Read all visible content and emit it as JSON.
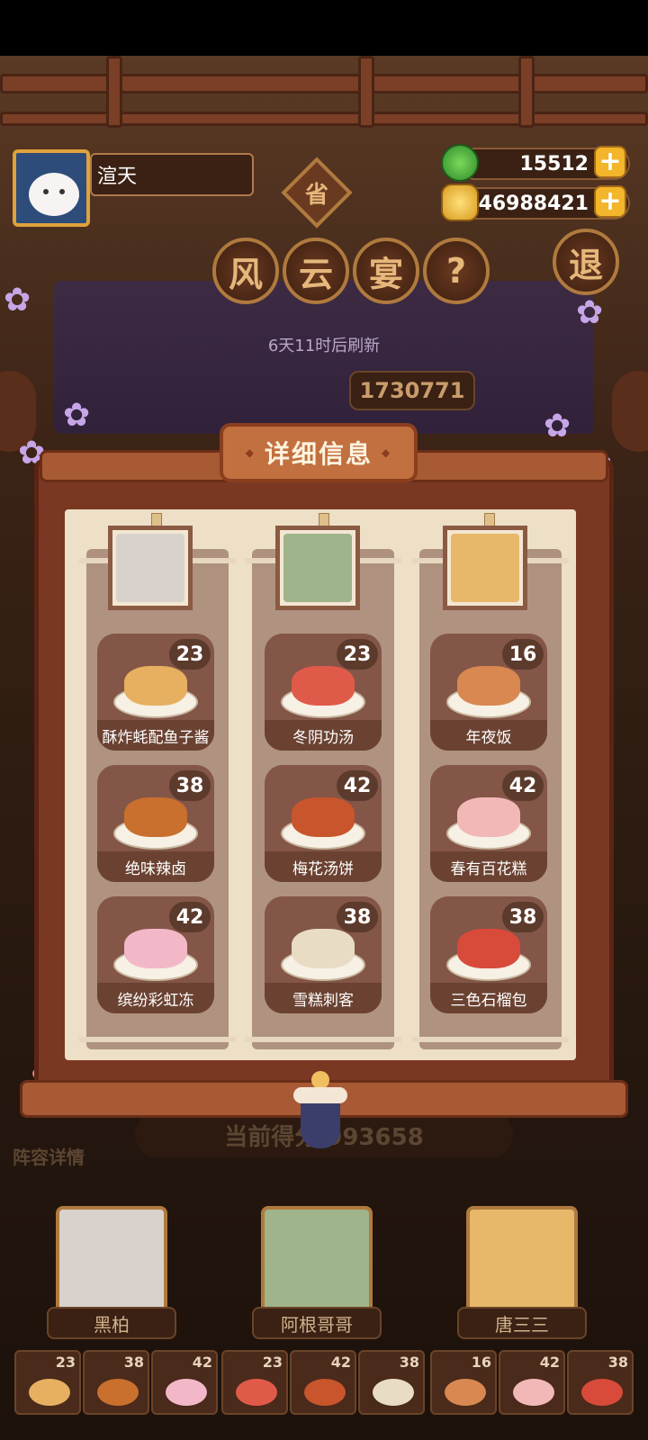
{
  "player": {
    "name": "渲天",
    "avatar_icon": "cat-avatar-icon"
  },
  "currency": {
    "jade": {
      "value": "15512",
      "icon": "jade-coin-icon",
      "color": "#3fae3a"
    },
    "gold": {
      "value": "46988421",
      "icon": "gold-coin-icon",
      "color": "#e7b23a"
    }
  },
  "event": {
    "province_label": "省",
    "title_chars": [
      "风",
      "云",
      "宴"
    ],
    "help_label": "?",
    "exit_label": "退",
    "refresh_text": "6天11时后刷新",
    "score_tag": "1730771"
  },
  "modal": {
    "title": "详细信息",
    "columns": [
      {
        "character": "黑柏",
        "portrait_color": "#d9d2cc",
        "dishes": [
          {
            "name": "酥炸蚝配鱼子酱",
            "count": "23",
            "color": "#e6b060"
          },
          {
            "name": "绝味辣卤",
            "count": "38",
            "color": "#c9702e"
          },
          {
            "name": "缤纷彩虹冻",
            "count": "42",
            "color": "#f3b8c8"
          }
        ]
      },
      {
        "character": "阿根哥哥",
        "portrait_color": "#9fb48a",
        "dishes": [
          {
            "name": "冬阴功汤",
            "count": "23",
            "color": "#e05a4a"
          },
          {
            "name": "梅花汤饼",
            "count": "42",
            "color": "#c8552c"
          },
          {
            "name": "雪糕刺客",
            "count": "38",
            "color": "#e8dcc4"
          }
        ]
      },
      {
        "character": "唐三三",
        "portrait_color": "#e7b86a",
        "dishes": [
          {
            "name": "年夜饭",
            "count": "16",
            "color": "#d88850"
          },
          {
            "name": "春有百花糕",
            "count": "42",
            "color": "#f2b8b8"
          },
          {
            "name": "三色石榴包",
            "count": "38",
            "color": "#d84a3a"
          }
        ]
      }
    ]
  },
  "bottom": {
    "lineup_label": "阵容详情",
    "score_text": "当前得分 993658",
    "characters": [
      "黑柏",
      "阿根哥哥",
      "唐三三"
    ],
    "mini_dishes": [
      {
        "count": "23",
        "color": "#e6b060"
      },
      {
        "count": "38",
        "color": "#c9702e"
      },
      {
        "count": "42",
        "color": "#f3b8c8"
      },
      {
        "count": "23",
        "color": "#e05a4a"
      },
      {
        "count": "42",
        "color": "#c8552c"
      },
      {
        "count": "38",
        "color": "#e8dcc4"
      },
      {
        "count": "16",
        "color": "#d88850"
      },
      {
        "count": "42",
        "color": "#f2b8b8"
      },
      {
        "count": "38",
        "color": "#d84a3a"
      }
    ]
  }
}
